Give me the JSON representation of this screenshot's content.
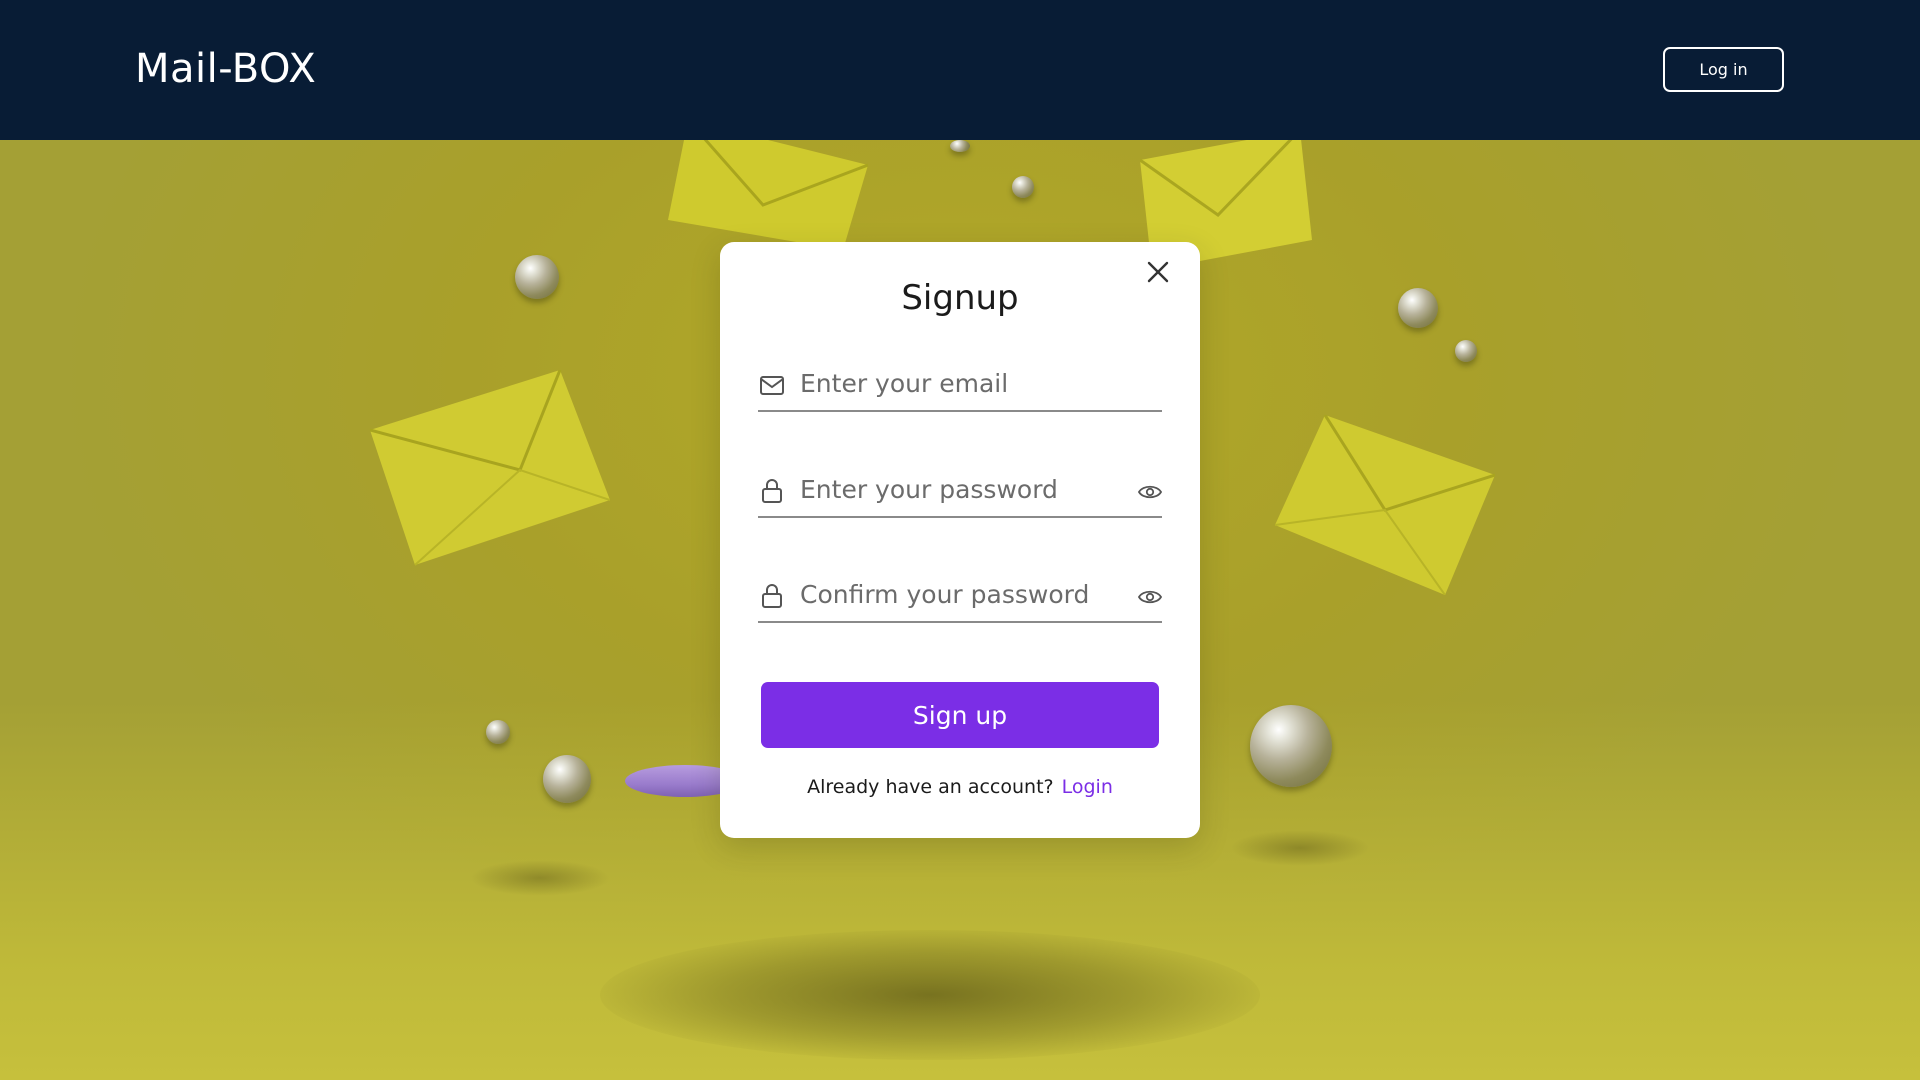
{
  "navbar": {
    "brand": "Mail-BOX",
    "login_label": "Log in"
  },
  "modal": {
    "title": "Signup",
    "close_icon": "close-icon",
    "fields": [
      {
        "placeholder": "Enter your email",
        "value": "",
        "icon": "mail-icon"
      },
      {
        "placeholder": "Enter your password",
        "value": "",
        "icon": "lock-icon",
        "toggle_icon": "eye-icon"
      },
      {
        "placeholder": "Confirm your password",
        "value": "",
        "icon": "lock-icon",
        "toggle_icon": "eye-icon"
      }
    ],
    "submit_label": "Sign up",
    "footer_text": "Already have an account?",
    "footer_link": "Login"
  },
  "colors": {
    "navbar_bg": "#081c35",
    "background": "#a9a02a",
    "accent": "#7b2ee6",
    "link": "#7b2ee6"
  }
}
